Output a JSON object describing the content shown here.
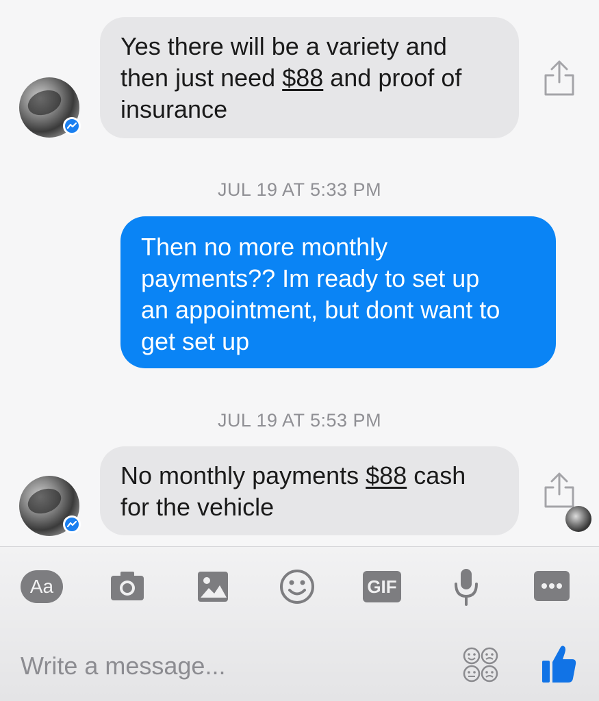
{
  "thread": {
    "messages": [
      {
        "direction": "incoming",
        "parts": [
          "Yes there will be a variety and",
          "then just need ",
          "$88",
          " and proof of",
          "insurance"
        ]
      },
      {
        "direction": "outgoing",
        "lines": [
          "Then no more monthly",
          "payments?? Im ready to set up",
          "an appointment, but dont want to",
          "get set up"
        ]
      },
      {
        "direction": "incoming",
        "parts": [
          "No monthly payments ",
          "$88",
          " cash",
          "for the vehicle"
        ]
      }
    ],
    "timestamps": [
      "JUL 19 AT 5:33 PM",
      "JUL 19 AT 5:53 PM"
    ]
  },
  "composer": {
    "aa_label": "Aa",
    "gif_label": "GIF",
    "placeholder": "Write a message...",
    "tools": [
      "text-format-button",
      "camera-icon",
      "image-icon",
      "emoji-icon",
      "gif-icon",
      "microphone-icon",
      "more-icon",
      "sticker-icon",
      "like-icon"
    ]
  },
  "colors": {
    "outgoing_bubble": "#0a84f5",
    "incoming_bubble": "#e6e6e8",
    "badge": "#1a7ff0",
    "like": "#1173e6"
  }
}
